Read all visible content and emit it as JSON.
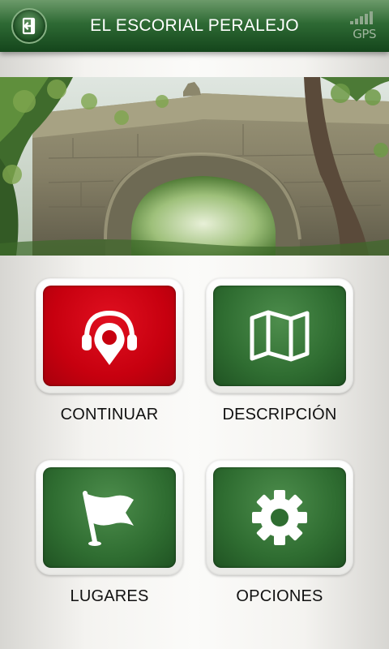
{
  "header": {
    "title": "EL ESCORIAL PERALEJO",
    "back_icon": "exit-icon",
    "gps_label": "GPS"
  },
  "hero": {
    "image": "stone-arch-bridge-photo"
  },
  "menu": {
    "items": [
      {
        "label": "CONTINUAR",
        "icon": "headphones-location-icon",
        "color": "#c7000f"
      },
      {
        "label": "DESCRIPCIÓN",
        "icon": "map-icon",
        "color": "#2f6d31"
      },
      {
        "label": "LUGARES",
        "icon": "flag-icon",
        "color": "#2f6d31"
      },
      {
        "label": "OPCIONES",
        "icon": "gear-icon",
        "color": "#2f6d31"
      }
    ]
  }
}
